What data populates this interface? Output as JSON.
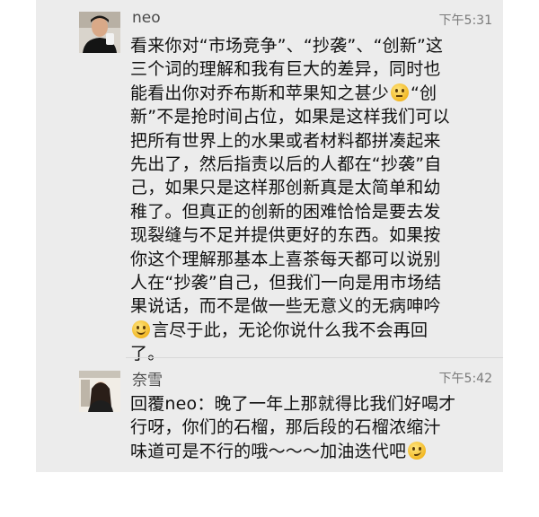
{
  "messages": [
    {
      "sender": "neo",
      "time": "下午5:31",
      "lines": [
        "看来你对“市场竞争”、“抄袭”、“创新”这",
        "三个词的理解和我有巨大的差异，同时也",
        "能看出你对乔布斯和苹果知之甚少",
        "新”不是抢时间占位，如果是这样我们可以",
        "把所有世界上的水果或者材料都拼凑起来",
        "先出了，然后指责以后的人都在“抄袭”自",
        "己，如果只是这样那创新真是太简单和幼",
        "稚了。但真正的创新的困难恰恰是要去发",
        "现裂缝与不足并提供更好的东西。如果按",
        "你这个理解那基本上喜茶每天都可以说别",
        "人在“抄袭”自己，但我们一向是用市场结",
        "果说话，而不是做一些无意义的无病呻吟",
        "言尽于此，无论你说什么我不会再回",
        "了。"
      ],
      "line3_tail": "“创",
      "emojis": [
        "thinking-emoji",
        "smile-emoji"
      ]
    },
    {
      "sender": "奈雪",
      "time": "下午5:42",
      "lines": [
        "回覆neo：晚了一年上那就得比我们好喝才",
        "行呀，你们的石榴，那后段的石榴浓缩汁",
        "味道可是不行的哦～～～加油迭代吧"
      ],
      "emojis": [
        "smirk-emoji"
      ]
    }
  ]
}
